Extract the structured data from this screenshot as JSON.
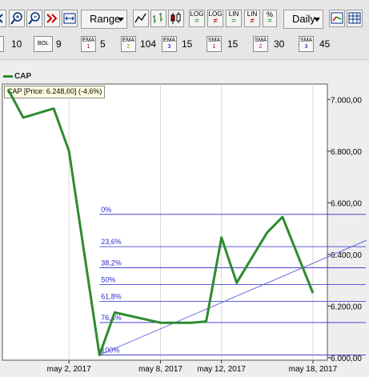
{
  "toolbar": {
    "range_label": "Range",
    "period_label": "Daily",
    "scale_buttons": [
      {
        "top": "LOG",
        "bottom": "="
      },
      {
        "top": "LOG",
        "bottom": "≠"
      },
      {
        "top": "LIN",
        "bottom": "="
      },
      {
        "top": "LIN",
        "bottom": "≠"
      },
      {
        "top": "%",
        "bottom": "="
      }
    ],
    "icons": [
      "nav-left-icon",
      "zoom-in-icon",
      "zoom-out-icon",
      "fast-forward-icon",
      "fit-icon",
      "line-chart-icon",
      "bar-chart-icon",
      "candlestick-icon",
      "settings-icon",
      "grid-icon"
    ]
  },
  "indicators": [
    {
      "name": "A",
      "sub": "",
      "value": "10"
    },
    {
      "name": "BOL",
      "sub": "",
      "value": "9"
    },
    {
      "name": "EMA",
      "sub": "1",
      "value": "5"
    },
    {
      "name": "EMA",
      "sub": "2",
      "value": "104"
    },
    {
      "name": "EMA",
      "sub": "3",
      "value": "15"
    },
    {
      "name": "SMA",
      "sub": "1",
      "value": "15"
    },
    {
      "name": "SMA",
      "sub": "2",
      "value": "30"
    },
    {
      "name": "SMA",
      "sub": "3",
      "value": "45"
    }
  ],
  "legend": {
    "label": "CAP",
    "color": "#2e8b2e"
  },
  "price_box": "CAP [Price: 6.248,80] (-4,6%)",
  "chart_data": {
    "type": "line",
    "series": [
      {
        "name": "CAP",
        "color": "#2e8b2e",
        "x": [
          "2017-04-28",
          "2017-04-29",
          "2017-05-01",
          "2017-05-02",
          "2017-05-04",
          "2017-05-05",
          "2017-05-08",
          "2017-05-09",
          "2017-05-10",
          "2017-05-11",
          "2017-05-12",
          "2017-05-13",
          "2017-05-15",
          "2017-05-16",
          "2017-05-18"
        ],
        "values": [
          7040,
          6930,
          6965,
          6800,
          6010,
          6175,
          6135,
          6135,
          6135,
          6140,
          6465,
          6290,
          6485,
          6545,
          6250
        ]
      }
    ],
    "x_tick_labels": [
      "may 2, 2017",
      "may 8, 2017",
      "may 12, 2017",
      "may 18, 2017"
    ],
    "y_tick_labels": [
      "7.000,00",
      "6.800,00",
      "6.600,00",
      "6.400,00",
      "6.200,00",
      "6.000,00"
    ],
    "ylim": [
      5990,
      7060
    ],
    "fibonacci": {
      "color": "#2a2acc",
      "levels": [
        {
          "label": "0%",
          "value": 6555
        },
        {
          "label": "23,6%",
          "value": 6430
        },
        {
          "label": "38,2%",
          "value": 6348
        },
        {
          "label": "50%",
          "value": 6283
        },
        {
          "label": "61,8%",
          "value": 6218
        },
        {
          "label": "76,4%",
          "value": 6136
        },
        {
          "label": "100%",
          "value": 6010
        }
      ]
    },
    "trendline": {
      "color": "#6a6ae0",
      "from": {
        "x": "2017-05-04",
        "value": 6010
      },
      "to": {
        "x": "2017-05-19",
        "value": 6430
      }
    },
    "grid": "vertical",
    "legend_position": "top-left"
  }
}
